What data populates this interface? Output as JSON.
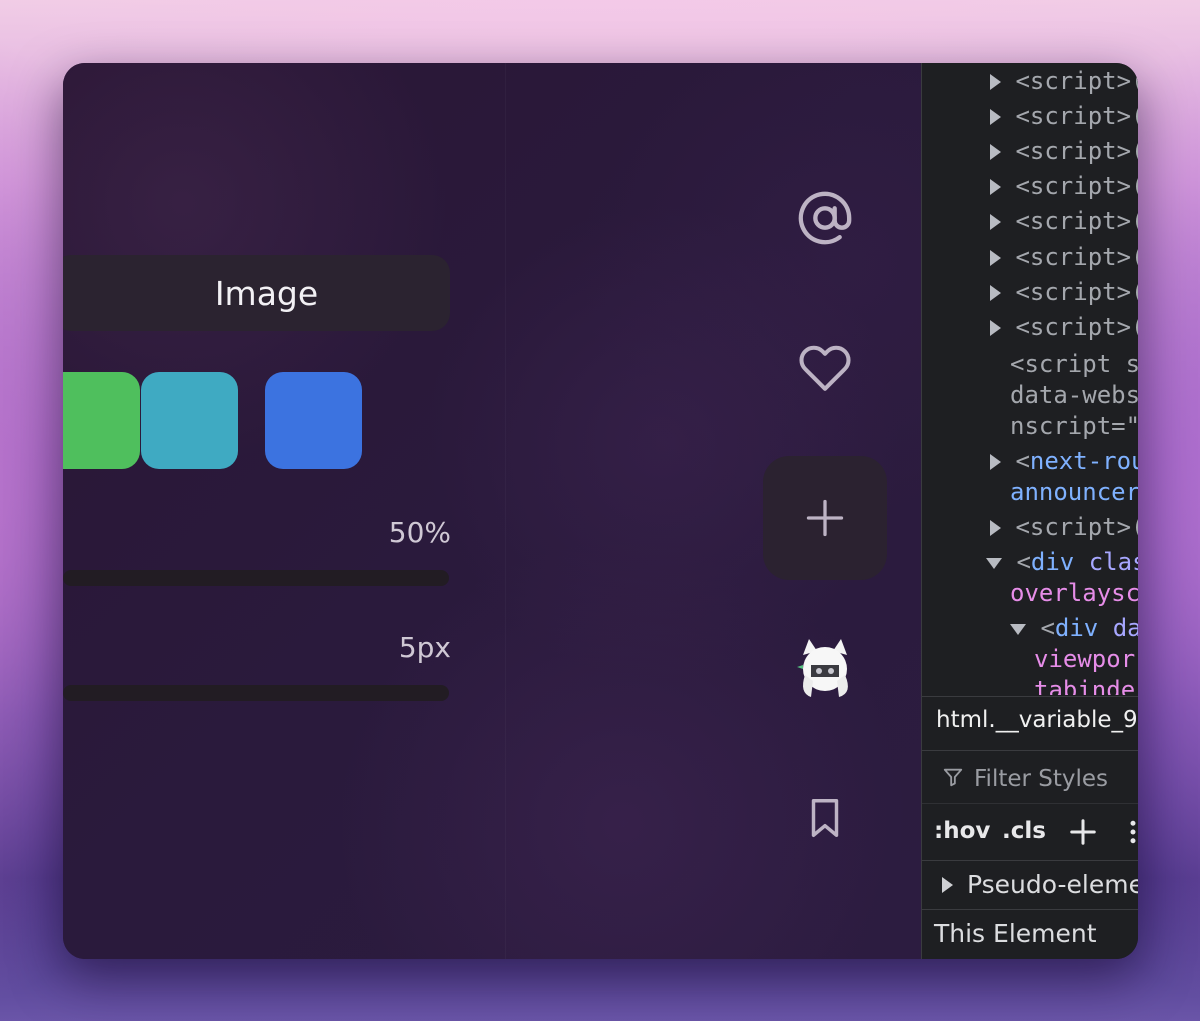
{
  "editor": {
    "tab_label": "Image",
    "swatches": [
      {
        "name": "green",
        "color": "#4fbf5d"
      },
      {
        "name": "teal",
        "color": "#3faac2"
      },
      {
        "name": "blue",
        "color": "#3c73e0"
      }
    ],
    "opacity_value": "50%",
    "size_value": "5px"
  },
  "rail": {
    "icons": [
      "at-sign-icon",
      "heart-icon",
      "plus-icon",
      "avatar",
      "bookmark-icon"
    ]
  },
  "devtools": {
    "code_lines": [
      {
        "tri": "right",
        "tag": "<script>",
        "trail": "(",
        "cls": "c-tag"
      },
      {
        "tri": "right",
        "tag": "<script>",
        "trail": "(",
        "cls": "c-tag"
      },
      {
        "tri": "right",
        "tag": "<script>",
        "trail": "(",
        "cls": "c-tag"
      },
      {
        "tri": "right",
        "tag": "<script>",
        "trail": "(",
        "cls": "c-tag"
      },
      {
        "tri": "right",
        "tag": "<script>",
        "trail": "(",
        "cls": "c-tag"
      },
      {
        "tri": "right",
        "tag": "<script>",
        "trail": "(",
        "cls": "c-tag"
      },
      {
        "tri": "right",
        "tag": "<script>",
        "trail": "(",
        "cls": "c-tag"
      },
      {
        "tri": "right",
        "tag": "<script>",
        "trail": "(",
        "cls": "c-tag"
      }
    ],
    "script_s": "<script s",
    "data_webs": "data-webs",
    "nscript": "nscript=\"",
    "next_route_open": "<",
    "next_route_tag": "next-rou",
    "announcer": "announcer",
    "script_after": "<script>",
    "script_after_trail": "(",
    "div_class_open": "<",
    "div_class_tag": "div",
    "div_class_attr": " clas",
    "overlaysc": "overlaysc",
    "div_da_open": "<",
    "div_da_tag": "div",
    "div_da_attr": " da",
    "viewpor": "viewpor",
    "tabinde": "tabinde",
    "breadcrumb": "html.__variable_9",
    "filter_placeholder": "Filter Styles",
    "hov_label": ":hov",
    "cls_label": ".cls",
    "pseudo_label": "Pseudo-eleme",
    "this_element": "This Element"
  }
}
